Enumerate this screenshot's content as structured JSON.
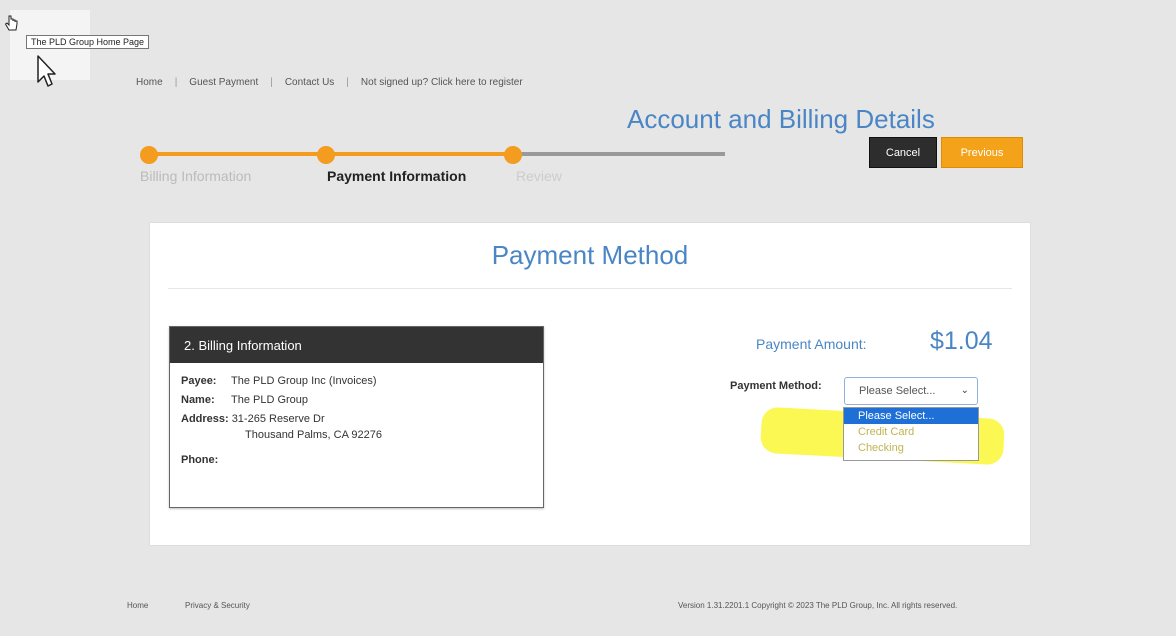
{
  "tooltip": "The PLD Group Home Page",
  "nav": {
    "home": "Home",
    "guest_payment": "Guest Payment",
    "contact": "Contact Us",
    "register": "Not signed up? Click here to register"
  },
  "page_title": "Account and Billing Details",
  "buttons": {
    "cancel": "Cancel",
    "previous": "Previous"
  },
  "steps": [
    {
      "label": "Billing Information",
      "state": "completed"
    },
    {
      "label": "Payment Information",
      "state": "current"
    },
    {
      "label": "Review",
      "state": "upcoming"
    }
  ],
  "card": {
    "title": "Payment Method",
    "billing": {
      "header": "2. Billing Information",
      "payee_label": "Payee:",
      "payee": "The PLD Group Inc (Invoices)",
      "name_label": "Name:",
      "name": "The PLD Group",
      "address_label": "Address:",
      "address_line1": "31-265 Reserve Dr",
      "address_line2": "Thousand Palms, CA 92276",
      "phone_label": "Phone:"
    },
    "amount_label": "Payment Amount:",
    "amount": "$1.04",
    "method_label": "Payment Method:",
    "method_selected": "Please Select...",
    "method_options": [
      "Please Select...",
      "Credit Card",
      "Checking"
    ]
  },
  "footer": {
    "home": "Home",
    "privacy": "Privacy & Security",
    "version": "Version 1.31.2201.1 Copyright © 2023 The PLD Group, Inc. All rights reserved."
  },
  "colors": {
    "accent_orange": "#f39c1f",
    "title_blue": "#4a86c5",
    "dropdown_selected": "#1e6fd6",
    "highlighter": "#f8f228"
  },
  "icons": [
    "hand-pointer-icon",
    "arrow-pointer-icon",
    "chevron-down-icon"
  ]
}
